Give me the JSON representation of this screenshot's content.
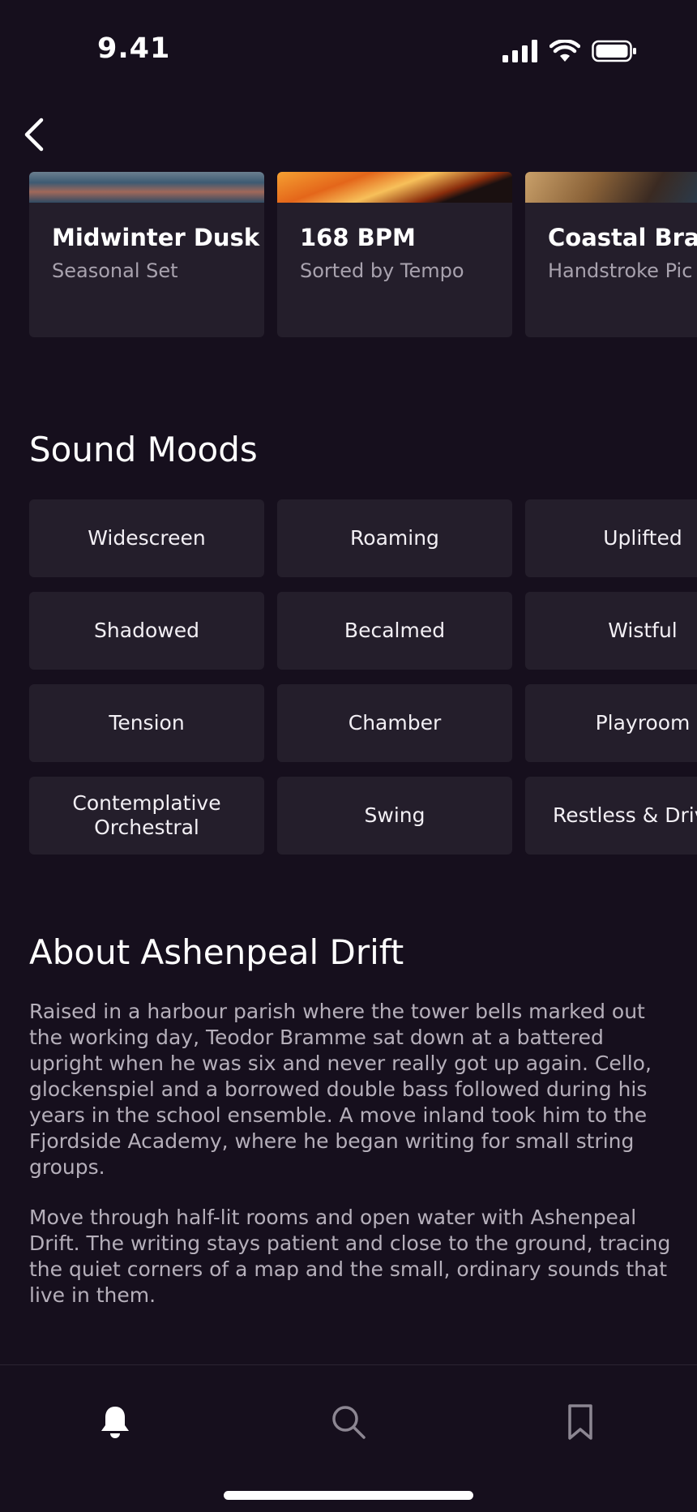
{
  "status_bar": {
    "time": "9.41"
  },
  "cards": [
    {
      "title": "Midwinter Dusk",
      "subtitle": "Seasonal Set"
    },
    {
      "title": "168 BPM",
      "subtitle": "Sorted by Tempo"
    },
    {
      "title": "Coastal Brass",
      "subtitle": "Handstroke Pic"
    }
  ],
  "moods_section": {
    "title": "Sound Moods",
    "items": [
      "Widescreen",
      "Roaming",
      "Uplifted",
      "Shadowed",
      "Becalmed",
      "Wistful",
      "Tension",
      "Chamber",
      "Playroom",
      "Contemplative Orchestral",
      "Swing",
      "Restless & Driv"
    ]
  },
  "about": {
    "title": "About Ashenpeal Drift",
    "paragraphs": [
      "Raised in a harbour parish where the tower bells marked out the working day, Teodor Bramme sat down at a battered upright when he was six and never really got up again. Cello, glockenspiel and a borrowed double bass followed during his years in the school ensemble. A move inland took him to the Fjordside Academy, where he began writing for small string groups.",
      "Move through half-lit rooms and open water with Ashenpeal Drift. The writing stays patient and close to the ground, tracing the quiet corners of a map and the small, ordinary sounds that live in them."
    ]
  },
  "tab_bar": {
    "tabs": [
      {
        "icon": "bell-icon",
        "active": true
      },
      {
        "icon": "search-icon",
        "active": false
      },
      {
        "icon": "bookmark-icon",
        "active": false
      }
    ]
  },
  "colors": {
    "background": "#160f1d",
    "card": "#241e2b",
    "text_primary": "#ffffff",
    "text_secondary": "#a8a2ae"
  }
}
